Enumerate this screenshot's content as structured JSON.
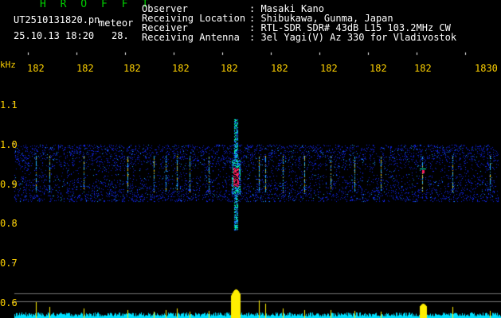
{
  "header": {
    "logo": "H R O F F T",
    "file_name": "UT2510131820.pn",
    "tag": "meteor",
    "datetime": "25.10.13 18:20",
    "count": "28."
  },
  "info": {
    "observer_label": "Observer",
    "observer_value": ": Masaki Kano",
    "location_label": "Receiving Location",
    "location_value": ": Shibukawa, Gunma, Japan",
    "receiver_label": "Receiver",
    "receiver_value": ": RTL-SDR SDR# 43dB L15 103.2MHz CW",
    "antenna_label": "Receiving Antenna",
    "antenna_value": ": 3el Yagi(V) Az 330 for Vladivostok"
  },
  "axis": {
    "unit": "kHz",
    "x_labels": [
      "182",
      "182",
      "182",
      "182",
      "182",
      "182",
      "182",
      "182",
      "182",
      "1830"
    ],
    "y_labels": [
      "1.1",
      "1.0",
      "0.9",
      "0.8",
      "0.7",
      "0.6"
    ]
  },
  "colors": {
    "text": "#ffffff",
    "logo": "#00d000",
    "axis": "#ffd200",
    "band_low": "#1a2bff",
    "band_high": "#ff2060",
    "spectrum": "#00e0ff",
    "peaks": "#ffee00"
  }
}
